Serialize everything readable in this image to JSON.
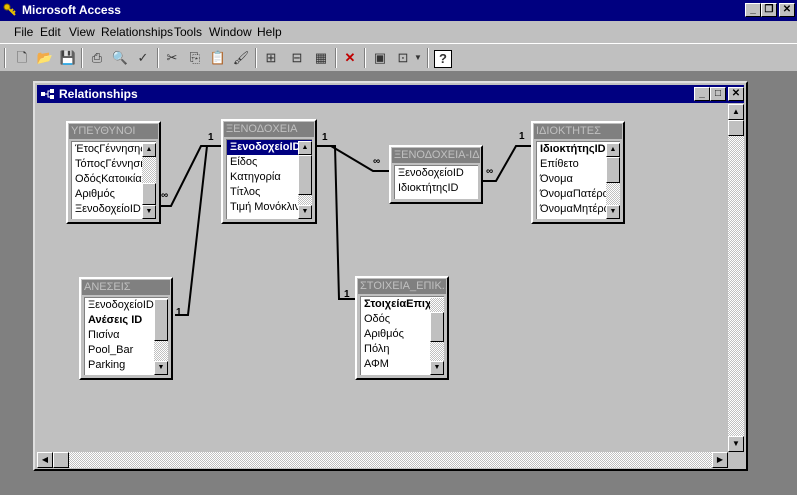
{
  "app": {
    "title": "Microsoft Access"
  },
  "menu": [
    {
      "label": "File"
    },
    {
      "label": "Edit"
    },
    {
      "label": "View"
    },
    {
      "label": "Relationships"
    },
    {
      "label": "Tools"
    },
    {
      "label": "Window"
    },
    {
      "label": "Help"
    }
  ],
  "window": {
    "title": "Relationships"
  },
  "tables": {
    "ypeythynoi": {
      "title": "ΥΠΕΥΘΥΝΟΙ",
      "fields": [
        "ΈτοςΓέννησης",
        "ΤόποςΓέννησης",
        "ΟδόςΚατοικίας",
        "Αριθμός",
        "ΞενοδοχείοID"
      ]
    },
    "xenodoxeia": {
      "title": "ΞΕΝΟΔΟΧΕΙΑ",
      "fields": [
        "ΞενοδοχείοID",
        "Είδος",
        "Κατηγορία",
        "Τίτλος",
        "Τιμή Μονόκλινου"
      ]
    },
    "xenodoxeia_id": {
      "title": "ΞΕΝΟΔΟΧΕΙΑ-ΙΔΙ...",
      "fields": [
        "ΞενοδοχείοID",
        "ΙδιοκτήτηςID"
      ]
    },
    "idioktites": {
      "title": "ΙΔΙΟΚΤΗΤΕΣ",
      "fields": [
        "ΙδιοκτήτηςID",
        "Επίθετο",
        "Όνομα",
        "ΌνομαΠατέρα",
        "ΌνομαΜητέρας"
      ]
    },
    "aneseis": {
      "title": "ΑΝΕΣΕΙΣ",
      "fields": [
        "ΞενοδοχείοID",
        "Ανέσεις ID",
        "Πισίνα",
        "Pool_Bar",
        "Parking"
      ]
    },
    "stoixeia": {
      "title": "ΣΤΟΙΧΕΙΑ_ΕΠΙΚ...",
      "fields": [
        "ΣτοιχείαΕπιχείρησηςID",
        "Οδός",
        "Αριθμός",
        "Πόλη",
        "ΑΦΜ"
      ]
    }
  },
  "relationship_labels": {
    "one": "1",
    "many": "∞"
  },
  "colors": {
    "title_bar": "#000080",
    "face": "#c0c0c0",
    "workspace": "#808080"
  }
}
